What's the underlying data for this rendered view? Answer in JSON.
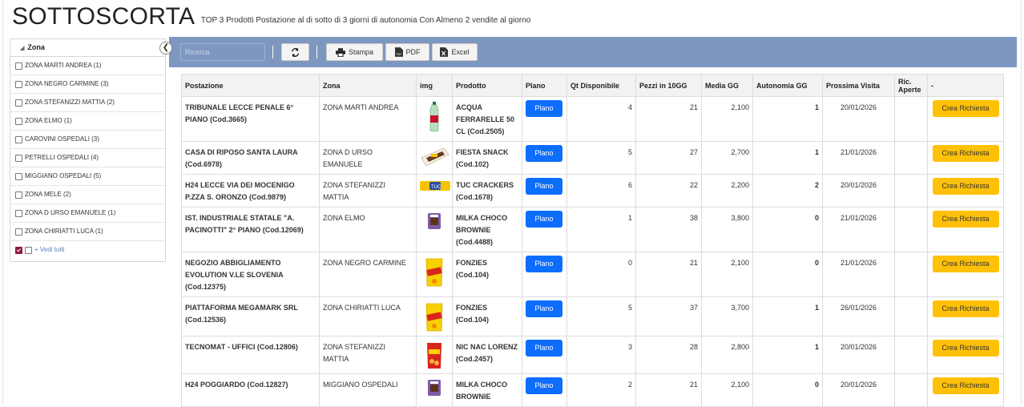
{
  "header": {
    "title": "SOTTOSCORTA",
    "subtitle": "TOP 3 Prodotti Postazione al di sotto di 3 giorni di autonomia Con Almeno 2 vendite al giorno"
  },
  "sidebar": {
    "title": "Zona",
    "zones": [
      {
        "label": "ZONA MARTI ANDREA (1)"
      },
      {
        "label": "ZONA NEGRO CARMINE (3)"
      },
      {
        "label": "ZONA STEFANIZZI MATTIA (2)"
      },
      {
        "label": "ZONA ELMO (1)"
      },
      {
        "label": "CAROVINI OSPEDALI (3)"
      },
      {
        "label": "PETRELLI OSPEDALI (4)"
      },
      {
        "label": "MIGGIANO OSPEDALI (5)"
      },
      {
        "label": "ZONA MELE (2)"
      },
      {
        "label": "ZONA D URSO EMANUELE (1)"
      },
      {
        "label": "ZONA CHIRIATTI LUCA (1)"
      }
    ],
    "see_all_label": "+ Vedi tutti"
  },
  "toolbar": {
    "search_placeholder": "Ricerca",
    "print_label": "Stampa",
    "pdf_label": "PDF",
    "excel_label": "Excel"
  },
  "table": {
    "headers": {
      "postazione": "Postazione",
      "zona": "Zona",
      "img": "img",
      "prodotto": "Prodotto",
      "plano": "Plano",
      "qt": "Qt Disponibile",
      "pezzi": "Pezzi in 10GG",
      "media": "Media GG",
      "autonomia": "Autonomia GG",
      "visita": "Prossima Visita",
      "ric": "Ric. Aperte",
      "action": "-"
    },
    "plano_label": "Plano",
    "request_label": "Crea Richiesta",
    "rows": [
      {
        "postazione": "TRIBUNALE LECCE PENALE 6° PIANO (Cod.3665)",
        "zona": "ZONA MARTI ANDREA",
        "prodotto": "ACQUA FERRARELLE 50 CL (Cod.2505)",
        "qt": "4",
        "pezzi": "21",
        "media": "2,100",
        "autonomia": "1",
        "visita": "20/01/2026",
        "ric": "",
        "img": "water-bottle"
      },
      {
        "postazione": "CASA DI RIPOSO SANTA LAURA (Cod.6978)",
        "zona": "ZONA D URSO EMANUELE",
        "prodotto": "FIESTA SNACK (Cod.102)",
        "qt": "5",
        "pezzi": "27",
        "media": "2,700",
        "autonomia": "1",
        "visita": "21/01/2026",
        "ric": "",
        "img": "snack-bar"
      },
      {
        "postazione": "H24 LECCE VIA DEI MOCENIGO P.ZZA S. ORONZO (Cod.9879)",
        "zona": "ZONA STEFANIZZI MATTIA",
        "prodotto": "TUC CRACKERS (Cod.1678)",
        "qt": "6",
        "pezzi": "22",
        "media": "2,200",
        "autonomia": "2",
        "visita": "20/01/2026",
        "ric": "",
        "img": "crackers-pack"
      },
      {
        "postazione": "IST. INDUSTRIALE STATALE \"A. PACINOTTI\" 2° PIANO (Cod.12069)",
        "zona": "ZONA ELMO",
        "prodotto": "MILKA CHOCO BROWNIE (Cod.4488)",
        "qt": "1",
        "pezzi": "38",
        "media": "3,800",
        "autonomia": "0",
        "visita": "21/01/2026",
        "ric": "",
        "img": "brownie-pack"
      },
      {
        "postazione": "NEGOZIO ABBIGLIAMENTO EVOLUTION V.LE SLOVENIA (Cod.12375)",
        "zona": "ZONA NEGRO CARMINE",
        "prodotto": "FONZIES (Cod.104)",
        "qt": "0",
        "pezzi": "21",
        "media": "2,100",
        "autonomia": "0",
        "visita": "21/01/2026",
        "ric": "",
        "img": "chips-bag"
      },
      {
        "postazione": "PIATTAFORMA MEGAMARK SRL (Cod.12536)",
        "zona": "ZONA CHIRIATTI LUCA",
        "prodotto": "FONZIES (Cod.104)",
        "qt": "5",
        "pezzi": "37",
        "media": "3,700",
        "autonomia": "1",
        "visita": "26/01/2026",
        "ric": "",
        "img": "chips-bag"
      },
      {
        "postazione": "TECNOMAT - UFFICI (Cod.12806)",
        "zona": "ZONA STEFANIZZI MATTIA",
        "prodotto": "NIC NAC LORENZ (Cod.2457)",
        "qt": "3",
        "pezzi": "28",
        "media": "2,800",
        "autonomia": "1",
        "visita": "20/01/2026",
        "ric": "",
        "img": "nuts-bag"
      },
      {
        "postazione": "H24 POGGIARDO (Cod.12827)",
        "zona": "MIGGIANO OSPEDALI",
        "prodotto": "MILKA CHOCO BROWNIE",
        "qt": "2",
        "pezzi": "21",
        "media": "2,100",
        "autonomia": "0",
        "visita": "20/01/2026",
        "ric": "",
        "img": "brownie-pack"
      }
    ]
  },
  "colors": {
    "toolbar_bg": "#7d97c0",
    "link": "#5b7fb7",
    "plano_button": "#0d6efd",
    "request_button": "#ffc107",
    "checked": "#8b1a3d"
  }
}
